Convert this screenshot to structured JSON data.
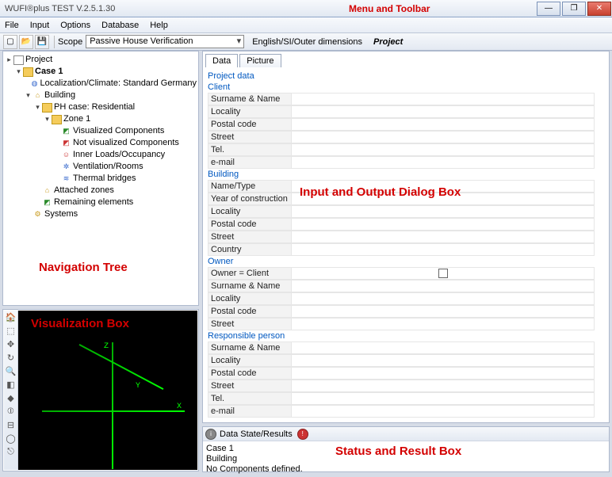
{
  "window": {
    "title": "WUFI®plus TEST V.2.5.1.30"
  },
  "menu": {
    "file": "File",
    "input": "Input",
    "options": "Options",
    "database": "Database",
    "help": "Help"
  },
  "toolbar": {
    "scope_label": "Scope",
    "scope_value": "Passive House Verification",
    "units": "English/SI/Outer dimensions",
    "project_label": "Project"
  },
  "annotations": {
    "menu": "Menu and Toolbar",
    "nav": "Navigation Tree",
    "io": "Input and Output Dialog Box",
    "viz": "Visualization Box",
    "status": "Status and Result Box"
  },
  "tree": {
    "project": "Project",
    "case": "Case 1",
    "loc": "Localization/Climate: Standard Germany",
    "building": "Building",
    "phcase": "PH case: Residential",
    "zone": "Zone 1",
    "vis": "Visualized Components",
    "notvis": "Not visualized Components",
    "inner": "Inner Loads/Occupancy",
    "vent": "Ventilation/Rooms",
    "thermal": "Thermal bridges",
    "attached": "Attached zones",
    "remaining": "Remaining elements",
    "systems": "Systems"
  },
  "tabs": {
    "data": "Data",
    "picture": "Picture"
  },
  "form": {
    "projectdata": "Project data",
    "client": "Client",
    "building": "Building",
    "owner": "Owner",
    "resp": "Responsible person",
    "surname": "Surname & Name",
    "locality": "Locality",
    "postal": "Postal code",
    "street": "Street",
    "tel": "Tel.",
    "email": "e-mail",
    "nametype": "Name/Type",
    "year": "Year of construction",
    "country": "Country",
    "ownerclient": "Owner = Client"
  },
  "viz": {
    "x": "X",
    "y": "Y",
    "z": "Z"
  },
  "status": {
    "header": "Data State/Results",
    "l1": "Case 1",
    "l2": "Building",
    "l3": "No Components defined."
  }
}
